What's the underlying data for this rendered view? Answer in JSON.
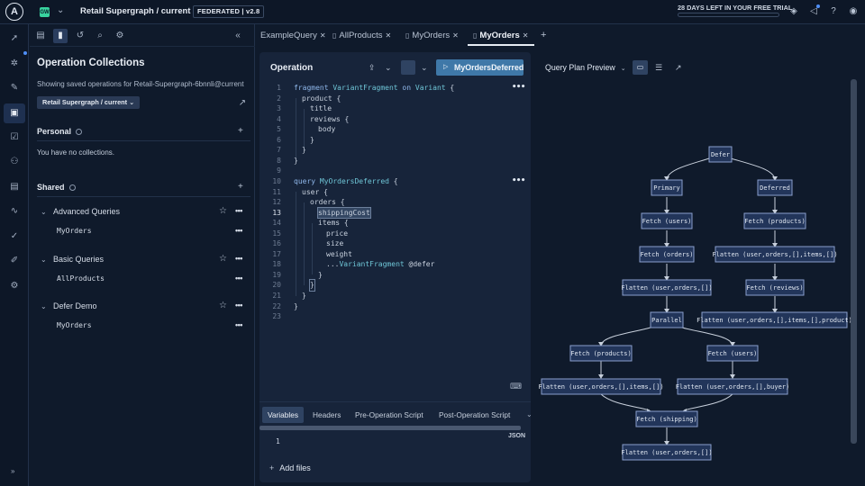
{
  "topbar": {
    "logo": "A",
    "org_badge": "GW",
    "graph_name": "Retail Supergraph / current",
    "federation_badge": "FEDERATED | v2.8",
    "trial_text": "28 DAYS LEFT IN YOUR FREE TRIAL"
  },
  "panel": {
    "title": "Operation Collections",
    "subtitle": "Showing saved operations for Retail-Supergraph-6bnnli@current",
    "variant_button": "Retail Supergraph / current",
    "personal": {
      "heading": "Personal",
      "empty_text": "You have no collections."
    },
    "shared": {
      "heading": "Shared",
      "collections": [
        {
          "name": "Advanced Queries",
          "operations": [
            "MyOrders"
          ]
        },
        {
          "name": "Basic Queries",
          "operations": [
            "AllProducts"
          ]
        },
        {
          "name": "Defer Demo",
          "operations": [
            "MyOrders"
          ]
        }
      ]
    }
  },
  "tabs": [
    "ExampleQuery",
    "AllProducts",
    "MyOrders",
    "MyOrders"
  ],
  "operation": {
    "title": "Operation",
    "run_button": "MyOrdersDeferred",
    "bottom_tabs": [
      "Variables",
      "Headers",
      "Pre-Operation Script",
      "Post-Operation Script"
    ],
    "variables_format": "JSON",
    "variables_line": "1",
    "add_files": "Add files"
  },
  "code": {
    "l1": {
      "a": "fragment ",
      "b": "VariantFragment",
      "c": " on ",
      "d": "Variant",
      "e": " {"
    },
    "l2": "product {",
    "l3": "title",
    "l4": "reviews {",
    "l5": "body",
    "l6": "}",
    "l7": "}",
    "l8": "}",
    "l10": {
      "a": "query ",
      "b": "MyOrdersDeferred",
      "c": " {"
    },
    "l11": "user {",
    "l12": "orders {",
    "l13": "shippingCost",
    "l14": "items {",
    "l15": "price",
    "l16": "size",
    "l17": "weight",
    "l18": {
      "a": "...",
      "b": "VariantFragment",
      "c": " @defer"
    },
    "l19": "}",
    "l20": "}",
    "l21": "}",
    "l22": "}"
  },
  "query_plan": {
    "title": "Query Plan Preview",
    "nodes": {
      "defer": "Defer",
      "primary": "Primary",
      "deferred": "Deferred",
      "fetch_users": "Fetch (users)",
      "fetch_products_d": "Fetch (products)",
      "fetch_orders": "Fetch (orders)",
      "flatten_items_d": "Flatten (user,orders,[],items,[])",
      "flatten_user_orders": "Flatten (user,orders,[])",
      "fetch_reviews": "Fetch (reviews)",
      "parallel": "Parallel",
      "flatten_product": "Flatten (user,orders,[],items,[],product)",
      "fetch_products": "Fetch (products)",
      "fetch_users2": "Fetch (users)",
      "flatten_items": "Flatten (user,orders,[],items,[])",
      "flatten_buyer": "Flatten (user,orders,[],buyer)",
      "fetch_shipping": "Fetch (shipping)",
      "flatten_final": "Flatten (user,orders,[])"
    }
  },
  "colors": {
    "background": "#0f1a2b",
    "run_button": "#3f78a8",
    "node_fill": "#22355a",
    "node_stroke": "#8a9fcc"
  }
}
